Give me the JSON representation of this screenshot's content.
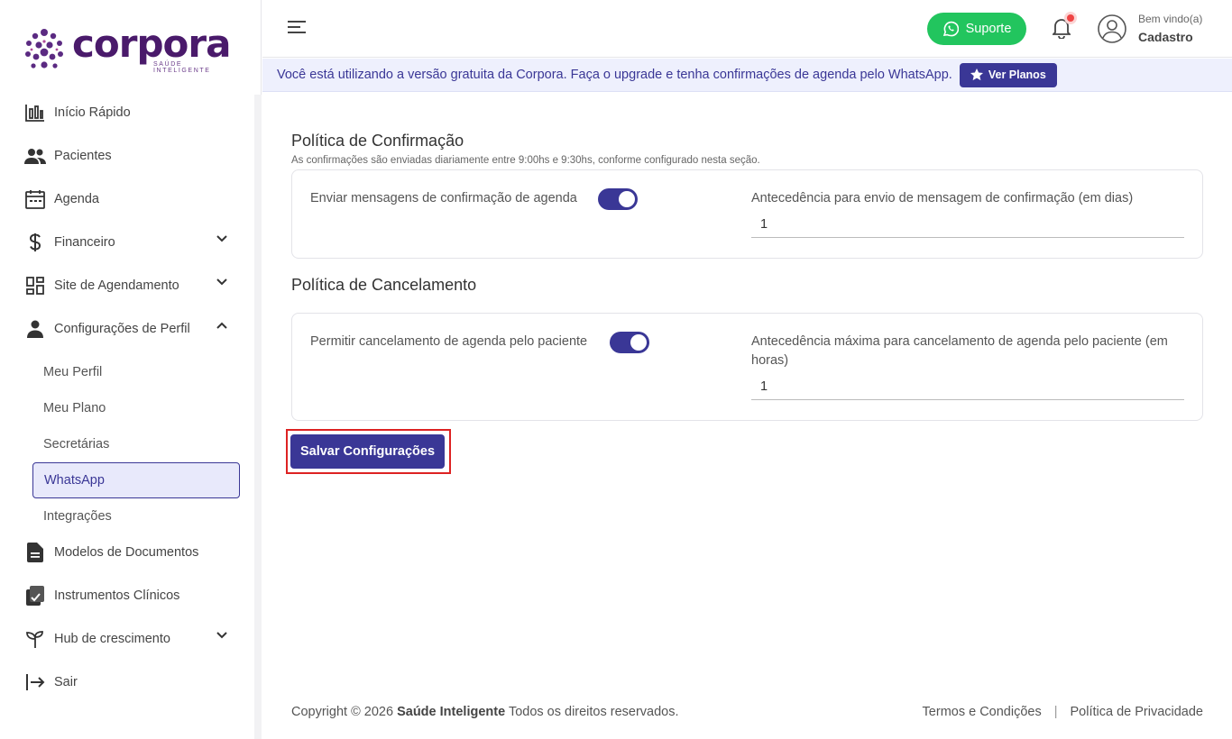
{
  "brand": {
    "name": "corpora",
    "tagline": "SAÚDE INTELIGENTE",
    "color": "#4a1a6b",
    "accent": "#3a3796"
  },
  "sidebar": {
    "items": [
      {
        "label": "Início Rápido",
        "icon": "bar-chart-icon"
      },
      {
        "label": "Pacientes",
        "icon": "users-icon"
      },
      {
        "label": "Agenda",
        "icon": "calendar-icon"
      },
      {
        "label": "Financeiro",
        "icon": "dollar-icon",
        "expandable": true
      },
      {
        "label": "Site de Agendamento",
        "icon": "dashboard-icon",
        "expandable": true
      },
      {
        "label": "Configurações de Perfil",
        "icon": "person-icon",
        "expanded": true
      },
      {
        "label": "Modelos de Documentos",
        "icon": "document-icon"
      },
      {
        "label": "Instrumentos Clínicos",
        "icon": "clipboard-icon"
      },
      {
        "label": "Hub de crescimento",
        "icon": "sprout-icon",
        "expandable": true
      },
      {
        "label": "Sair",
        "icon": "logout-icon"
      }
    ],
    "subitems": [
      {
        "label": "Meu Perfil"
      },
      {
        "label": "Meu Plano"
      },
      {
        "label": "Secretárias"
      },
      {
        "label": "WhatsApp",
        "active": true
      },
      {
        "label": "Integrações"
      }
    ]
  },
  "header": {
    "support_label": "Suporte",
    "welcome": "Bem vindo(a)",
    "username": "Cadastro"
  },
  "banner": {
    "text": "Você está utilizando a versão gratuita da Corpora. Faça o upgrade e tenha confirmações de agenda pelo WhatsApp.",
    "button": "Ver Planos"
  },
  "confirmation": {
    "title": "Política de Confirmação",
    "subtitle": "As confirmações são enviadas diariamente entre 9:00hs e 9:30hs, conforme configurado nesta seção.",
    "toggle_label": "Enviar mensagens de confirmação de agenda",
    "toggle_on": true,
    "field_label": "Antecedência para envio de mensagem de confirmação (em dias)",
    "field_value": "1"
  },
  "cancellation": {
    "title": "Política de Cancelamento",
    "toggle_label": "Permitir cancelamento de agenda pelo paciente",
    "toggle_on": true,
    "field_label": "Antecedência máxima para cancelamento de agenda pelo paciente (em horas)",
    "field_value": "1"
  },
  "save_button": "Salvar Configurações",
  "footer": {
    "copyright": "Copyright © 2026",
    "company": "Saúde Inteligente",
    "rights": "Todos os direitos reservados.",
    "terms": "Termos e Condições",
    "privacy": "Política de Privacidade"
  }
}
